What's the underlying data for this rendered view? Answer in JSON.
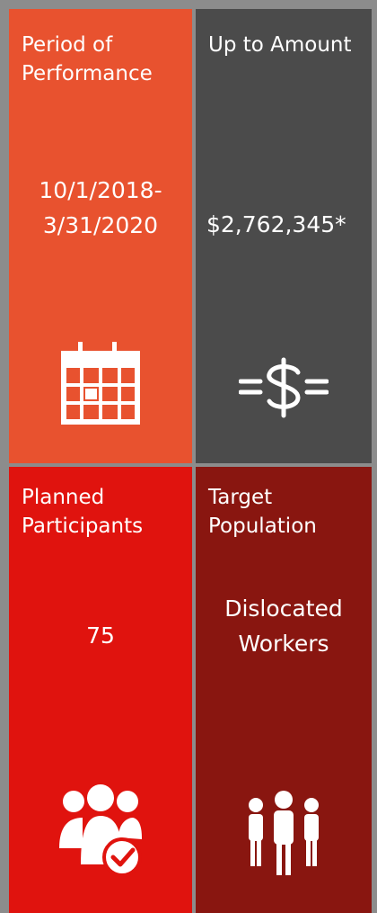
{
  "tiles": {
    "period": {
      "title": "Period of\nPerformance",
      "value": "10/1/2018-\n3/31/2020",
      "icon": "calendar-icon",
      "color": "#e8522f"
    },
    "amount": {
      "title": "Up to Amount",
      "value": "$2,762,345*",
      "icon": "dollar-icon",
      "color": "#4b4b4b"
    },
    "participants": {
      "title": "Planned\nParticipants",
      "value": "75",
      "icon": "group-check-icon",
      "color": "#e0130e"
    },
    "population": {
      "title": "Target\nPopulation",
      "value": "Dislocated\nWorkers",
      "icon": "people-icon",
      "color": "#891610"
    }
  }
}
